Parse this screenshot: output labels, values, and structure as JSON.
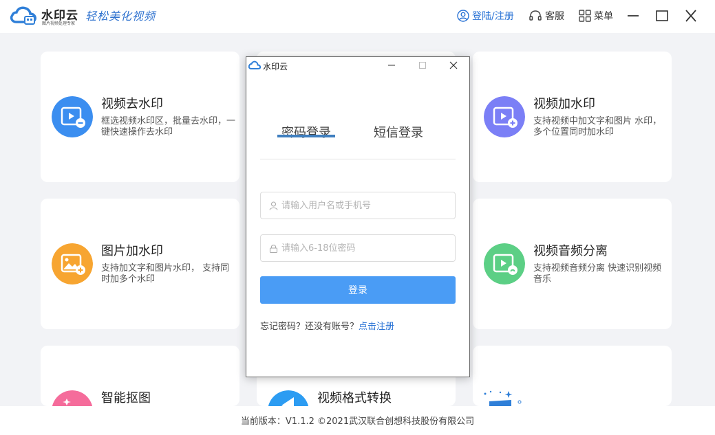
{
  "app": {
    "brand": "水印云",
    "brand_sub": "图片视频处理专家",
    "slogan": "轻松美化视频"
  },
  "titlebar": {
    "login_label": "登陆/注册",
    "service_label": "客服",
    "menu_label": "菜单"
  },
  "cards": [
    {
      "title": "视频去水印",
      "desc": "框选视频水印区，批量去水印，一键快速操作去水印",
      "icon": "video-remove-icon",
      "color": "#3b8ef0"
    },
    {
      "title": "视频加水印",
      "desc": "支持视频中加文字和图片 水印，多个位置同时加水印",
      "icon": "video-add-icon",
      "color": "#7b7ff6"
    },
    {
      "title": "图片加水印",
      "desc": "支持加文字和图片水印， 支持同时加多个水印",
      "icon": "image-add-icon",
      "color": "#f7a531"
    },
    {
      "title": "视频音频分离",
      "desc": "支持视频音频分离 快速识别视频音乐",
      "icon": "audio-separate-icon",
      "color": "#5ccf85"
    },
    {
      "title": "智能抠图",
      "desc": "",
      "icon": "cutout-icon",
      "color": "#f56c9b"
    },
    {
      "title": "视频格式转换",
      "desc": "",
      "icon": "format-convert-icon",
      "color": "#2c9cf2"
    }
  ],
  "dialog": {
    "title": "水印云",
    "tab_password": "密码登录",
    "tab_sms": "短信登录",
    "username_placeholder": "请输入用户名或手机号",
    "password_placeholder": "请输入6-18位密码",
    "login_button": "登录",
    "forgot_text": "忘记密码？还没有账号？",
    "register_link": "点击注册"
  },
  "footer": {
    "version_text": "当前版本：V1.1.2 ©2021武汉联合创想科技股份有限公司"
  }
}
